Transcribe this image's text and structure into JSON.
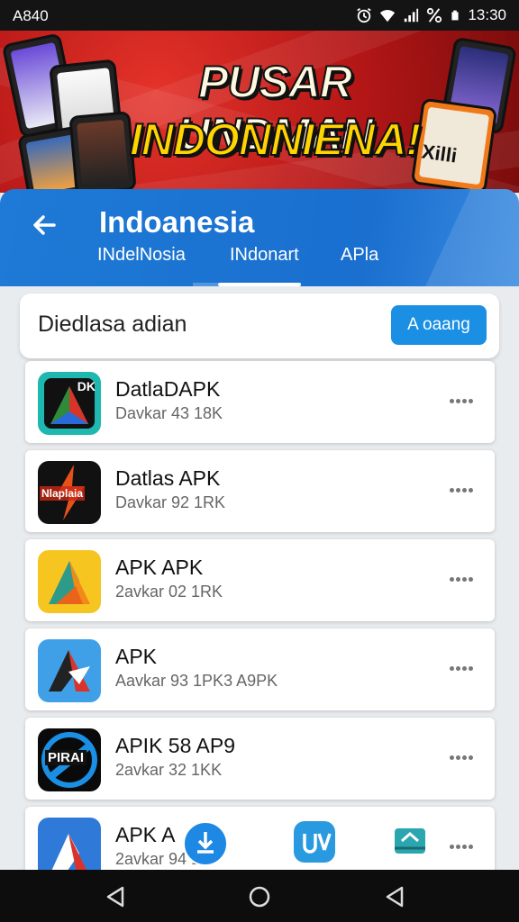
{
  "status_bar": {
    "left": "A840",
    "time": "13:30",
    "icons": [
      "alarm-icon",
      "wifi-icon",
      "signal-icon",
      "percent-icon",
      "battery-icon"
    ]
  },
  "banner": {
    "line1": "PUSAR UNDMAN",
    "line2": "INDONNIENA!",
    "side_text": "Xilli"
  },
  "appbar": {
    "title": "Indoanesia",
    "tabs": [
      "INdelNosia",
      "INdonart",
      "APla"
    ],
    "active_tab": 1
  },
  "search": {
    "placeholder": "Diedlasa adian",
    "button_label": "A oaang"
  },
  "apps": [
    {
      "name": "DatlaDAPK",
      "sub": "Davkar 43 18K",
      "icon_label": "DK"
    },
    {
      "name": "Datlas APK",
      "sub": "Davkar 92 1RK",
      "icon_label": "Nlaplaia"
    },
    {
      "name": "APK APK",
      "sub": "2avkar 02 1RK",
      "icon_label": ""
    },
    {
      "name": "APK",
      "sub": "Aavkar 93 1PK3 A9PK",
      "icon_label": ""
    },
    {
      "name": "APIK 58 AP9",
      "sub": "2avkar 32 1KK",
      "icon_label": "PIRAI"
    },
    {
      "name": "APK A",
      "sub": "2avkar 94 1K",
      "icon_label": ""
    }
  ],
  "colors": {
    "primary": "#1a6fcf",
    "accent": "#1a8fe3",
    "banner_red": "#c4161c",
    "title_yellow": "#ffd400"
  }
}
